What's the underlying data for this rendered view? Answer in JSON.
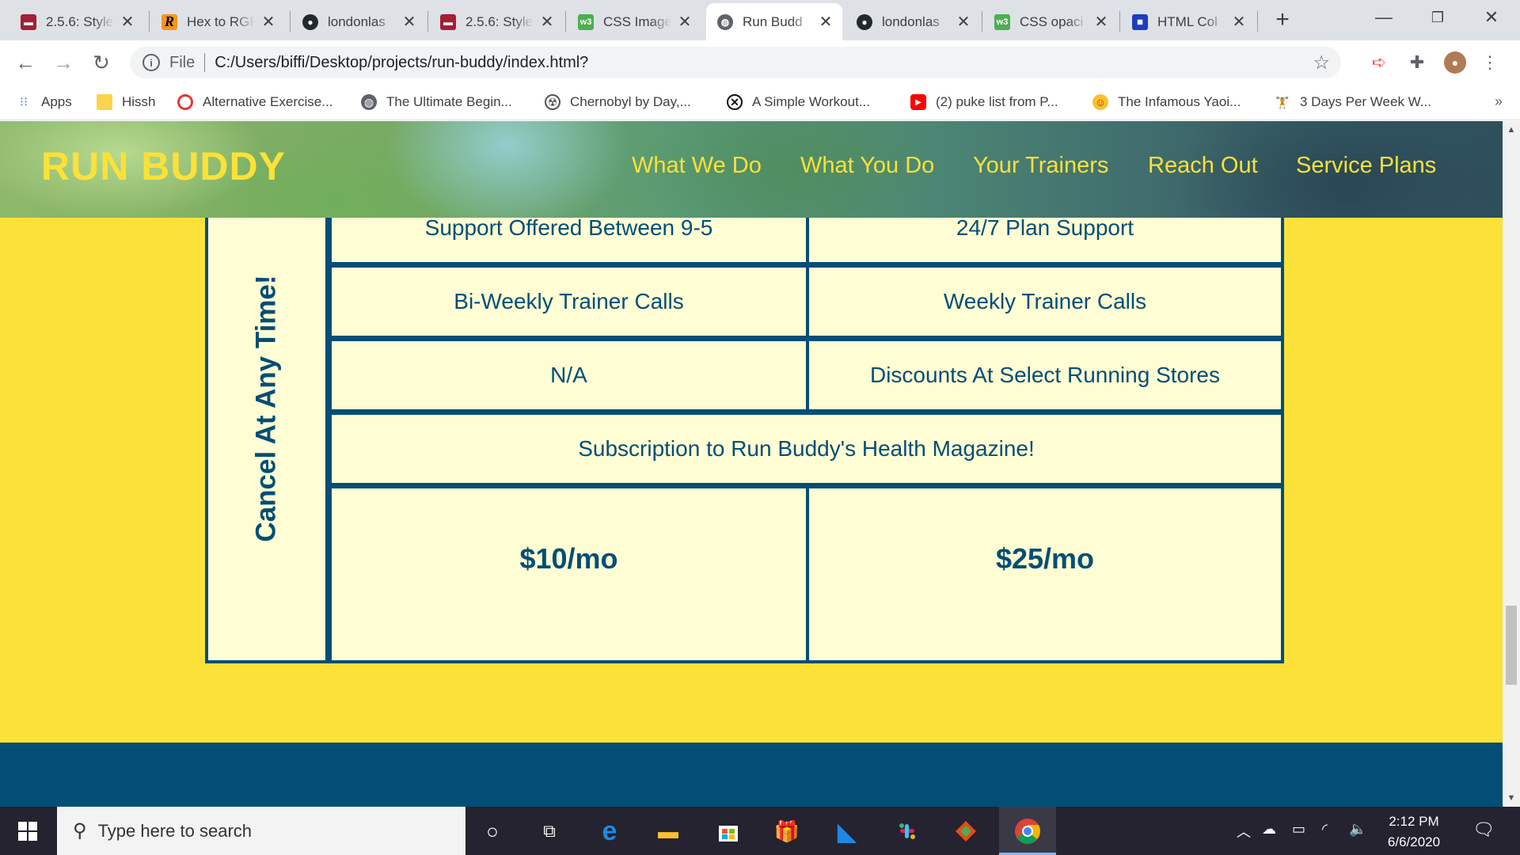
{
  "browser": {
    "tabs": [
      {
        "title": "2.5.6: Style",
        "favicon": "university-favicon",
        "color": "#a31f34"
      },
      {
        "title": "Hex to RGB",
        "favicon": "r-favicon",
        "color": "#f7941d"
      },
      {
        "title": "londonlas",
        "favicon": "github-icon",
        "color": "#24292e"
      },
      {
        "title": "2.5.6: Style",
        "favicon": "university-favicon",
        "color": "#a31f34"
      },
      {
        "title": "CSS Image",
        "favicon": "w3schools-favicon",
        "color": "#4caf50"
      },
      {
        "title": "Run Budd",
        "favicon": "globe-icon",
        "color": "#5f6368",
        "active": true
      },
      {
        "title": "londonlas",
        "favicon": "github-icon",
        "color": "#24292e"
      },
      {
        "title": "CSS opaci",
        "favicon": "w3schools-favicon",
        "color": "#4caf50"
      },
      {
        "title": "HTML Col",
        "favicon": "htmlcolor-favicon",
        "color": "#1a3fbf"
      }
    ],
    "new_tab": "+",
    "address": {
      "scheme": "File",
      "url": "C:/Users/biffi/Desktop/projects/run-buddy/index.html?"
    },
    "bookmarks": [
      {
        "label": "Apps",
        "icon": "apps-grid-icon"
      },
      {
        "label": "Hissh",
        "icon": "folder-icon"
      },
      {
        "label": "Alternative Exercise...",
        "icon": "target-icon"
      },
      {
        "label": "The Ultimate Begin...",
        "icon": "globe-icon"
      },
      {
        "label": "Chernobyl by Day,...",
        "icon": "radiation-icon"
      },
      {
        "label": "A Simple Workout...",
        "icon": "x-circle-icon"
      },
      {
        "label": "(2) puke list from P...",
        "icon": "youtube-icon"
      },
      {
        "label": "The Infamous Yaoi...",
        "icon": "emoji-icon"
      },
      {
        "label": "3 Days Per Week W...",
        "icon": "figure-icon"
      }
    ],
    "bookmarks_more": "»"
  },
  "site": {
    "brand": "RUN BUDDY",
    "nav": [
      "What We Do",
      "What You Do",
      "Your Trainers",
      "Reach Out",
      "Service Plans"
    ],
    "pricing": {
      "side_label": "Cancel At Any Time!",
      "rows": [
        [
          "Support Offered Between 9-5",
          "24/7 Plan Support"
        ],
        [
          "Bi-Weekly Trainer Calls",
          "Weekly Trainer Calls"
        ],
        [
          "N/A",
          "Discounts At Select Running Stores"
        ]
      ],
      "full_row": "Subscription to Run Buddy's Health Magazine!",
      "prices": [
        "$10/mo",
        "$25/mo"
      ]
    },
    "colors": {
      "primary": "#024e76",
      "accent": "#fce138",
      "cell": "#fffdd4"
    }
  },
  "taskbar": {
    "search_placeholder": "Type here to search",
    "time": "2:12 PM",
    "date": "6/6/2020"
  }
}
